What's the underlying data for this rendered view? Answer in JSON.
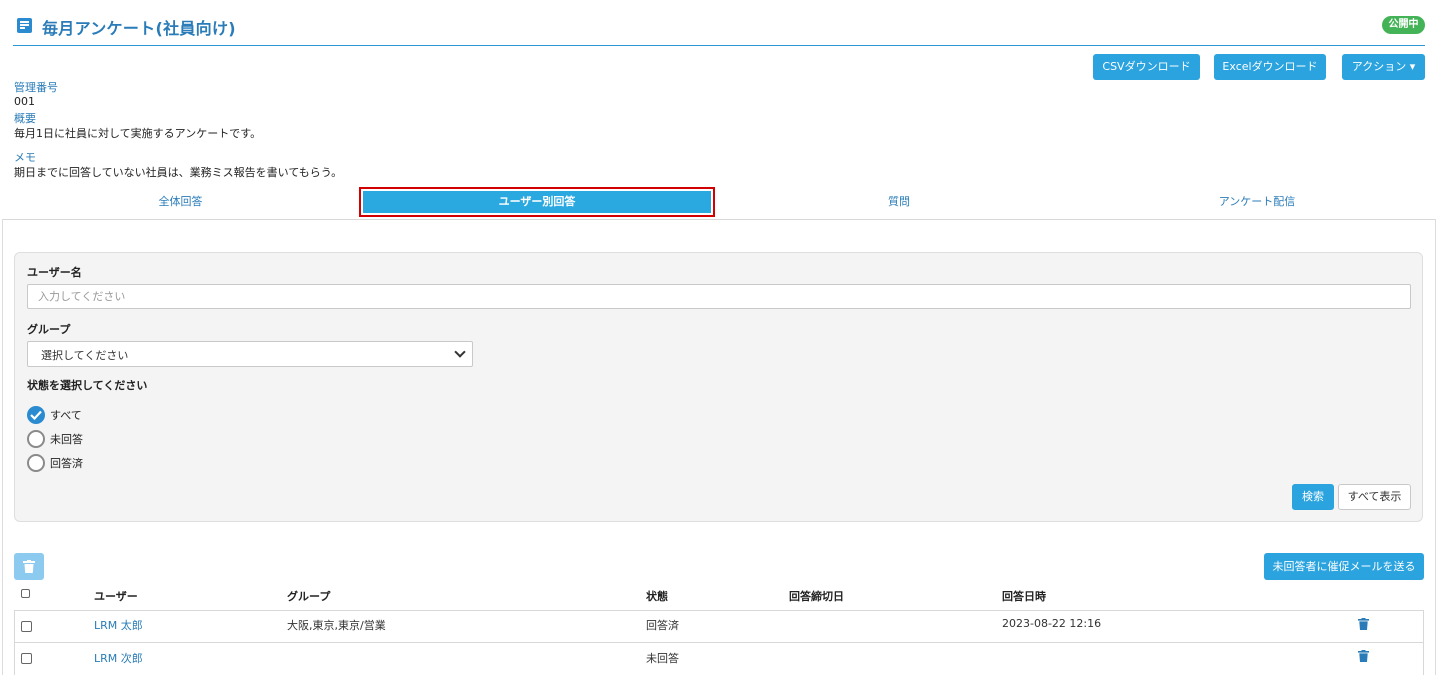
{
  "header": {
    "title": "毎月アンケート(社員向け)",
    "status": "公開中",
    "buttons": {
      "csv": "CSVダウンロード",
      "excel": "Excelダウンロード",
      "action": "アクション ▾"
    }
  },
  "meta": {
    "id_label": "管理番号",
    "id_value": "001",
    "summary_label": "概要",
    "summary_value": "毎月1日に社員に対して実施するアンケートです。",
    "memo_label": "メモ",
    "memo_value": "期日までに回答していない社員は、業務ミス報告を書いてもらう。"
  },
  "tabs": [
    {
      "label": "全体回答",
      "active": false
    },
    {
      "label": "ユーザー別回答",
      "active": true
    },
    {
      "label": "質問",
      "active": false
    },
    {
      "label": "アンケート配信",
      "active": false
    }
  ],
  "search": {
    "username_label": "ユーザー名",
    "username_placeholder": "入力してください",
    "group_label": "グループ",
    "group_selected": "選択してください",
    "status_label": "状態を選択してください",
    "status_options": [
      {
        "label": "すべて",
        "checked": true
      },
      {
        "label": "未回答",
        "checked": false
      },
      {
        "label": "回答済",
        "checked": false
      }
    ],
    "search_button": "検索",
    "show_all_button": "すべて表示"
  },
  "table": {
    "remind_button": "未回答者に催促メールを送る",
    "columns": [
      "ユーザー",
      "グループ",
      "状態",
      "回答締切日",
      "回答日時"
    ],
    "rows": [
      {
        "user": "LRM 太郎",
        "group": "大阪,東京,東京/営業",
        "status": "回答済",
        "deadline": "",
        "answered_at": "2023-08-22 12:16"
      },
      {
        "user": "LRM 次郎",
        "group": "",
        "status": "未回答",
        "deadline": "",
        "answered_at": ""
      }
    ]
  },
  "colors": {
    "accent": "#2aa3df",
    "link": "#2a7cb8",
    "status_badge": "#44b357",
    "highlight": "#d20000"
  }
}
